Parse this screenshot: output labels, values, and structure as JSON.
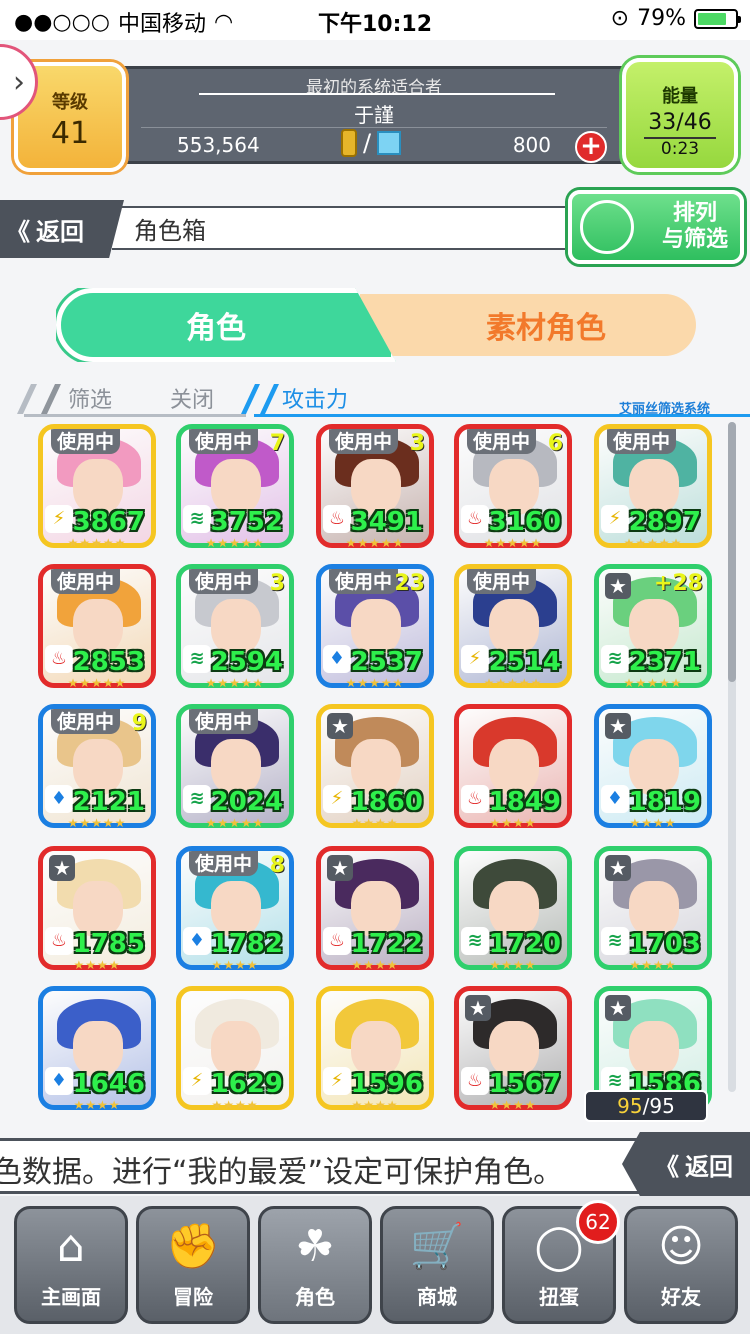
{
  "status_bar": {
    "carrier": "中国移动",
    "time": "下午10:12",
    "battery": "79%",
    "signal_icon": "signal-dots",
    "wifi_icon": "wifi-icon",
    "lock_icon": "rotation-lock-icon",
    "battery_fill": 0.79
  },
  "header": {
    "level_label": "等级",
    "level_value": "41",
    "player_title": "最初的系统适合者",
    "player_name": "于謹",
    "coins": "553,564",
    "separator": "/",
    "gems": "800",
    "add_label": "+",
    "energy_label": "能量",
    "energy_value": "33/46",
    "energy_timer": "0:23"
  },
  "nav": {
    "back_label": "返回",
    "back_chevron": "《",
    "page_title": "角色箱",
    "sort_label_line1": "排列",
    "sort_label_line2": "与筛选"
  },
  "tabs": {
    "character": "角色",
    "material": "素材角色"
  },
  "filter": {
    "filter_label": "筛选",
    "filter_state": "关闭",
    "sort_key": "攻击力",
    "system_label": "艾丽丝筛选系统"
  },
  "cards": [
    {
      "in_use": "使用中",
      "plus": "",
      "power": "3867",
      "frame": "yellow",
      "type": "thunder",
      "type_glyph": "⚡",
      "hair": "#f29ac0",
      "stars": "★★★★★"
    },
    {
      "in_use": "使用中",
      "plus": "7",
      "power": "3752",
      "frame": "green",
      "type": "wind",
      "type_glyph": "≋",
      "hair": "#c05ac9",
      "stars": "★★★★★"
    },
    {
      "in_use": "使用中",
      "plus": "3",
      "power": "3491",
      "frame": "red",
      "type": "fire",
      "type_glyph": "♨",
      "hair": "#6b2e1e",
      "stars": "★★★★★"
    },
    {
      "in_use": "使用中",
      "plus": "6",
      "power": "3160",
      "frame": "red",
      "type": "fire",
      "type_glyph": "♨",
      "hair": "#b7b9c0",
      "stars": "★★★★★"
    },
    {
      "in_use": "使用中",
      "plus": "",
      "power": "2897",
      "frame": "yellow",
      "type": "thunder",
      "type_glyph": "⚡",
      "hair": "#4fb3a2",
      "stars": "★★★★★"
    },
    {
      "in_use": "使用中",
      "plus": "",
      "power": "2853",
      "frame": "red",
      "type": "fire",
      "type_glyph": "♨",
      "hair": "#f1a33b",
      "stars": "★★★★★"
    },
    {
      "in_use": "使用中",
      "plus": "3",
      "power": "2594",
      "frame": "green",
      "type": "wind",
      "type_glyph": "≋",
      "hair": "#c7c9cf",
      "stars": "★★★★★"
    },
    {
      "in_use": "使用中",
      "plus": "23",
      "power": "2537",
      "frame": "blue",
      "type": "water",
      "type_glyph": "♦",
      "hair": "#5b4fa8",
      "stars": "★★★★★"
    },
    {
      "in_use": "使用中",
      "plus": "",
      "power": "2514",
      "frame": "yellow",
      "type": "thunder",
      "type_glyph": "⚡",
      "hair": "#2b3f8f",
      "stars": "★★★★★"
    },
    {
      "in_use": "",
      "plus": "+28",
      "power": "2371",
      "frame": "green",
      "type": "wind",
      "type_glyph": "≋",
      "hair": "#6ad07e",
      "stars": "★★★★★",
      "star_badge": "★"
    },
    {
      "in_use": "使用中",
      "plus": "9",
      "power": "2121",
      "frame": "blue",
      "type": "water",
      "type_glyph": "♦",
      "hair": "#e9c58b",
      "stars": "★★★★★"
    },
    {
      "in_use": "使用中",
      "plus": "",
      "power": "2024",
      "frame": "green",
      "type": "wind",
      "type_glyph": "≋",
      "hair": "#3a2e6b",
      "stars": "★★★★★"
    },
    {
      "in_use": "",
      "plus": "",
      "power": "1860",
      "frame": "yellow",
      "type": "thunder",
      "type_glyph": "⚡",
      "hair": "#c08a5a",
      "stars": "★★★★",
      "star_badge": "★"
    },
    {
      "in_use": "",
      "plus": "",
      "power": "1849",
      "frame": "red",
      "type": "fire",
      "type_glyph": "♨",
      "hair": "#d9392c",
      "stars": "★★★★"
    },
    {
      "in_use": "",
      "plus": "",
      "power": "1819",
      "frame": "blue",
      "type": "water",
      "type_glyph": "♦",
      "hair": "#7fd6ec",
      "stars": "★★★★",
      "star_badge": "★"
    },
    {
      "in_use": "",
      "plus": "",
      "power": "1785",
      "frame": "red",
      "type": "fire",
      "type_glyph": "♨",
      "hair": "#f2dcae",
      "stars": "★★★★",
      "star_badge": "★"
    },
    {
      "in_use": "使用中",
      "plus": "8",
      "power": "1782",
      "frame": "blue",
      "type": "water",
      "type_glyph": "♦",
      "hair": "#35b8cf",
      "stars": "★★★★"
    },
    {
      "in_use": "",
      "plus": "",
      "power": "1722",
      "frame": "red",
      "type": "fire",
      "type_glyph": "♨",
      "hair": "#4a2a5e",
      "stars": "★★★★",
      "star_badge": "★"
    },
    {
      "in_use": "",
      "plus": "",
      "power": "1720",
      "frame": "green",
      "type": "wind",
      "type_glyph": "≋",
      "hair": "#3e4a3a",
      "stars": "★★★★"
    },
    {
      "in_use": "",
      "plus": "",
      "power": "1703",
      "frame": "green",
      "type": "wind",
      "type_glyph": "≋",
      "hair": "#9a97a8",
      "stars": "★★★★",
      "star_badge": "★"
    },
    {
      "in_use": "",
      "plus": "",
      "power": "1646",
      "frame": "blue",
      "type": "water",
      "type_glyph": "♦",
      "hair": "#3b5fc9",
      "stars": "★★★★"
    },
    {
      "in_use": "",
      "plus": "",
      "power": "1629",
      "frame": "yellow",
      "type": "thunder",
      "type_glyph": "⚡",
      "hair": "#f0eadf",
      "stars": "★★★★"
    },
    {
      "in_use": "",
      "plus": "",
      "power": "1596",
      "frame": "yellow",
      "type": "thunder",
      "type_glyph": "⚡",
      "hair": "#f2c83a",
      "stars": "★★★★"
    },
    {
      "in_use": "",
      "plus": "",
      "power": "1567",
      "frame": "red",
      "type": "fire",
      "type_glyph": "♨",
      "hair": "#2d2a2a",
      "stars": "★★★★",
      "star_badge": "★"
    },
    {
      "in_use": "",
      "plus": "",
      "power": "1586",
      "frame": "green",
      "type": "wind",
      "type_glyph": "≋",
      "hair": "#8fe0c0",
      "stars": "★★★★",
      "star_badge": "★"
    }
  ],
  "count": {
    "current": "95",
    "sep": "/",
    "max": "95"
  },
  "ticker": {
    "text": "色数据。进行“我的最爱”设定可保护角色。",
    "back_label": "返回",
    "back_chevron": "《"
  },
  "bottom_nav": [
    {
      "label": "主画面",
      "icon": "home-icon",
      "glyph": "⌂"
    },
    {
      "label": "冒险",
      "icon": "handshake-icon",
      "glyph": "✊"
    },
    {
      "label": "角色",
      "icon": "rabbit-icon",
      "glyph": "☘"
    },
    {
      "label": "商城",
      "icon": "cart-icon",
      "glyph": "🛒"
    },
    {
      "label": "扭蛋",
      "icon": "egg-icon",
      "glyph": "◯"
    },
    {
      "label": "好友",
      "icon": "friends-icon",
      "glyph": "☺"
    }
  ],
  "gacha_badge": "62"
}
